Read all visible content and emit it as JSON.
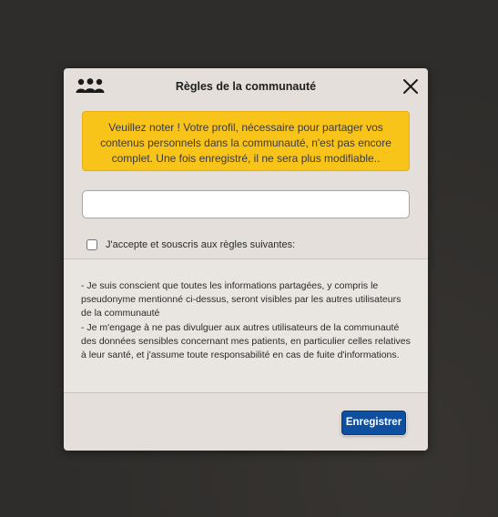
{
  "dialog": {
    "title": "Règles de la communauté",
    "header_icon": "community-icon",
    "close_icon": "close-icon",
    "notice": "Veuillez noter ! Votre profil, nécessaire pour partager vos contenus personnels dans la communauté, n'est pas encore complet. Une fois enregistré, il ne sera plus modifiable..",
    "pseudo_input": {
      "value": "",
      "placeholder": ""
    },
    "accept": {
      "checked": false,
      "label": "J'accepte et souscris aux règles suivantes:"
    },
    "rules": [
      "- Je suis conscient que toutes les informations partagées, y compris le pseudonyme mentionné ci-dessus, seront visibles par les autres utilisateurs de la communauté",
      "- Je m'engage à ne pas divulguer aux autres utilisateurs de la communauté des données sensibles concernant mes patients, en particulier celles relatives à leur santé, et j'assume toute responsabilité en cas de fuite d'informations."
    ],
    "save_label": "Enregistrer"
  },
  "colors": {
    "backdrop": "#2f2d2b",
    "dialog_bg": "#e4dfda",
    "notice_bg": "#f9c41a",
    "primary_button": "#0e4fa0"
  }
}
